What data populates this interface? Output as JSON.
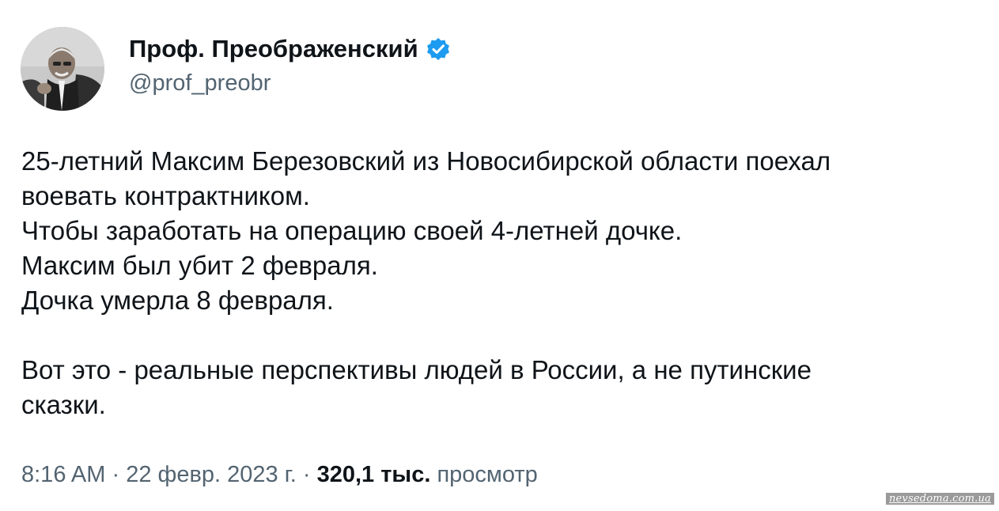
{
  "author": {
    "display_name": "Проф. Преображенский",
    "handle": "@prof_preobr",
    "verified": true,
    "avatar_icon": "avatar-photo"
  },
  "tweet": {
    "lines": [
      "25-летний Максим Березовский из Новосибирской области поехал",
      "воевать контрактником.",
      "Чтобы заработать на операцию своей 4-летней дочке.",
      "Максим был убит 2 февраля.",
      "Дочка умерла 8 февраля.",
      "",
      "Вот это - реальные перспективы людей в России, а не путинские",
      "сказки."
    ]
  },
  "meta": {
    "time": "8:16 AM",
    "separator": " · ",
    "date": "22 февр. 2023 г.",
    "views_count": "320,1 тыс.",
    "views_label": "просмотр"
  },
  "watermark": "nevsedoma.com.ua",
  "colors": {
    "text_primary": "#0f1419",
    "text_secondary": "#536471",
    "verified_blue": "#1d9bf0"
  }
}
